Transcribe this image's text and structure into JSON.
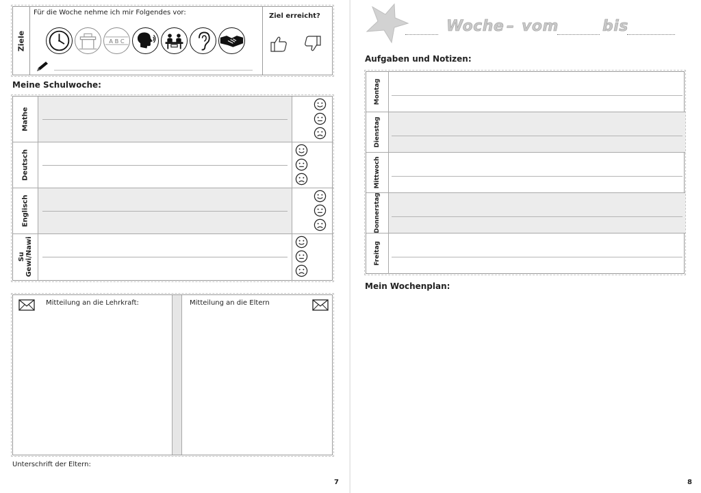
{
  "left_page": {
    "goals": {
      "label": "Ziele",
      "intro": "Für die Woche nehme ich mir Folgendes vor:",
      "icons": [
        "clock-icon",
        "desk-icon",
        "abc-icon",
        "speaking-head-icon",
        "group-table-icon",
        "ear-icon",
        "handshake-icon"
      ],
      "abc_text": "A B C",
      "reached_label": "Ziel erreicht?",
      "reached_icons": [
        "thumbs-up-icon",
        "thumbs-down-icon"
      ]
    },
    "school_week": {
      "heading": "Meine Schulwoche:",
      "subjects": [
        {
          "label": "Mathe",
          "shaded": true
        },
        {
          "label": "Deutsch",
          "shaded": false
        },
        {
          "label": "Englisch",
          "shaded": true
        },
        {
          "label": "Su\nGewi/Nawi",
          "shaded": false
        }
      ],
      "face_icons": [
        "smiling-face-icon",
        "neutral-face-icon",
        "sad-face-icon"
      ]
    },
    "messages": {
      "teacher_label": "Mitteilung an die Lehrkraft:",
      "parents_label": "Mitteilung an die Eltern",
      "icon": "envelope-icon"
    },
    "signature_label": "Unterschrift der Eltern:",
    "page_number": "7"
  },
  "right_page": {
    "title": {
      "star_icon": "star-icon",
      "word_week": "Woche",
      "word_dash": "–",
      "word_from": "vom",
      "word_to": "bis"
    },
    "tasks_heading": "Aufgaben und Notizen:",
    "days": [
      {
        "label": "Montag",
        "shaded": false
      },
      {
        "label": "Dienstag",
        "shaded": true
      },
      {
        "label": "Mittwoch",
        "shaded": false
      },
      {
        "label": "Donnerstag",
        "shaded": true
      },
      {
        "label": "Freitag",
        "shaded": false
      }
    ],
    "weekplan_heading": "Mein Wochenplan:",
    "page_number": "8"
  }
}
